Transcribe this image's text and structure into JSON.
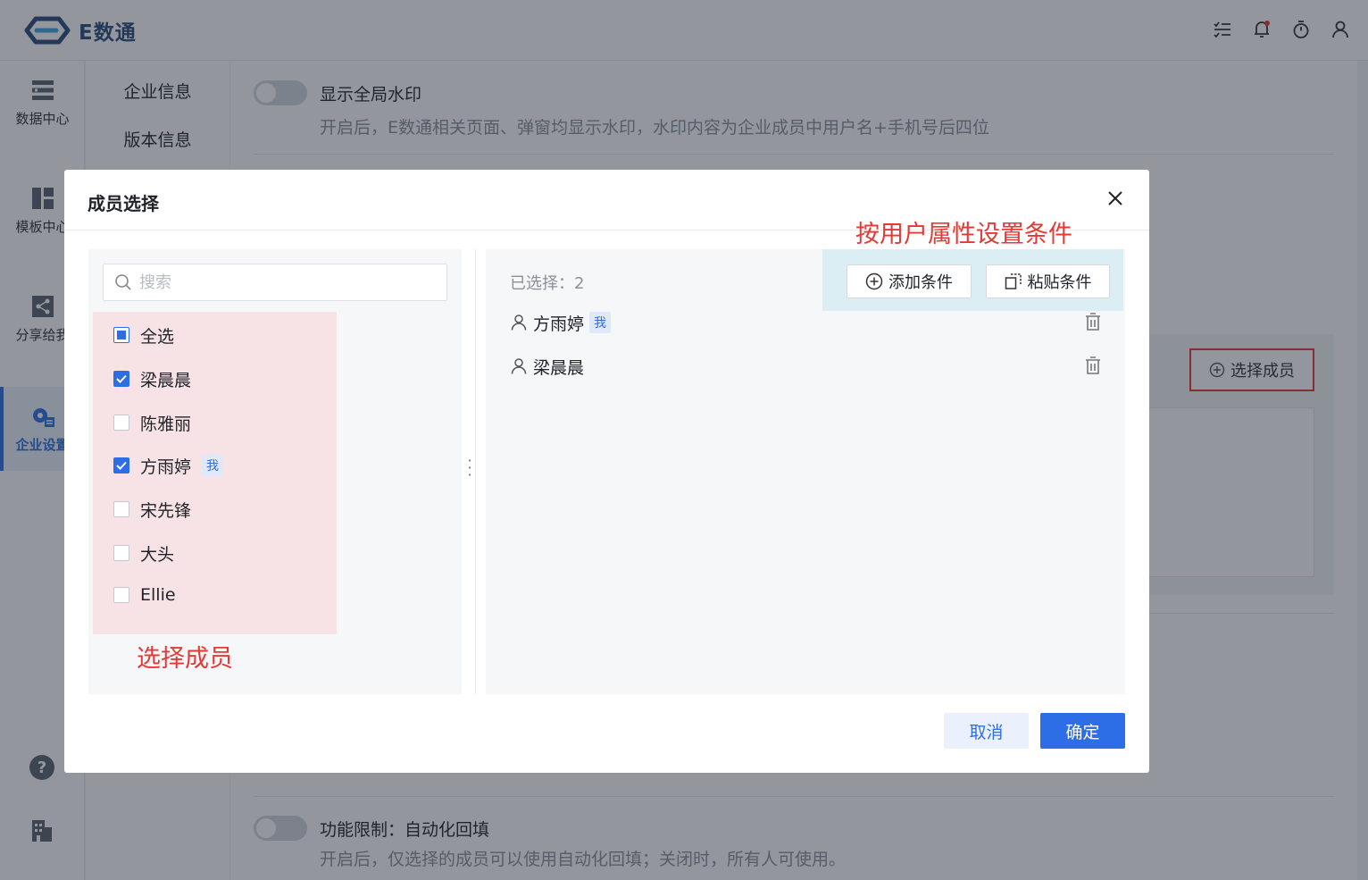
{
  "app": {
    "logo_text": "E数通"
  },
  "header": {
    "icons": [
      "task-list-icon",
      "bell-icon",
      "timer-icon",
      "user-icon"
    ]
  },
  "rail": {
    "items": [
      {
        "label": "数据中心",
        "icon": "data-center-icon"
      },
      {
        "label": "模板中心",
        "icon": "template-center-icon"
      },
      {
        "label": "分享给我",
        "icon": "share-icon"
      },
      {
        "label": "企业设置",
        "icon": "enterprise-settings-icon",
        "active": true
      }
    ],
    "bottom_icons": [
      "help-icon",
      "building-icon"
    ]
  },
  "subnav": {
    "items": [
      "企业信息",
      "版本信息"
    ]
  },
  "settings": {
    "watermark": {
      "title": "显示全局水印",
      "desc": "开启后，E数通相关页面、弹窗均显示水印，水印内容为企业成员中用户名+手机号后四位",
      "enabled": false
    },
    "autofill": {
      "title": "功能限制：自动化回填",
      "desc": "开启后，仅选择的成员可以使用自动化回填；关闭时，所有人可使用。",
      "enabled": false
    },
    "select_member_btn": "选择成员"
  },
  "modal": {
    "title": "成员选择",
    "search": {
      "placeholder": "搜索",
      "value": ""
    },
    "members": [
      {
        "name": "全选",
        "state": "partial",
        "me": false
      },
      {
        "name": "梁晨晨",
        "state": "checked",
        "me": false
      },
      {
        "name": "陈雅丽",
        "state": "unchecked",
        "me": false
      },
      {
        "name": "方雨婷",
        "state": "checked",
        "me": true
      },
      {
        "name": "宋先锋",
        "state": "unchecked",
        "me": false
      },
      {
        "name": "大头",
        "state": "unchecked",
        "me": false
      },
      {
        "name": "Ellie",
        "state": "unchecked",
        "me": false
      }
    ],
    "me_tag": "我",
    "selected_label": "已选择：2",
    "selected": [
      {
        "name": "方雨婷",
        "me": true
      },
      {
        "name": "梁晨晨",
        "me": false
      }
    ],
    "add_condition": "添加条件",
    "paste_condition": "粘贴条件",
    "cancel": "取消",
    "confirm": "确定"
  },
  "annotations": {
    "select_members": "选择成员",
    "set_conditions": "按用户属性设置条件"
  },
  "colors": {
    "primary": "#2d6ee6",
    "annotation": "#e53935",
    "highlight_members": "#f7e3e5",
    "highlight_conditions": "#dbeef4"
  }
}
